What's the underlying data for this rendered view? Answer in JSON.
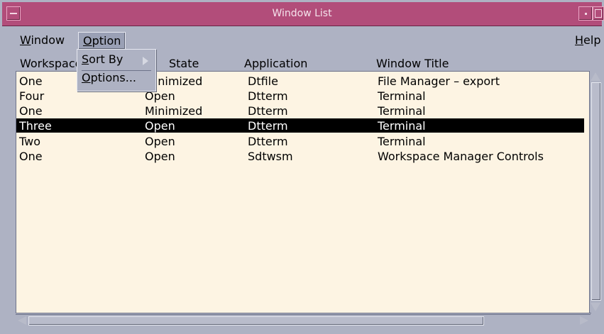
{
  "window": {
    "title": "Window List",
    "colors": {
      "titlebar": "#b24d7a",
      "chrome": "#aeb2c3",
      "list_bg": "#fdf4e3",
      "selected_bg": "#000000",
      "selected_fg": "#ffffff"
    }
  },
  "menubar": {
    "window": {
      "prefix": "",
      "underline": "W",
      "rest": "indow"
    },
    "option": {
      "prefix": "",
      "underline": "O",
      "rest": "ption"
    },
    "help": {
      "prefix": "",
      "underline": "H",
      "rest": "elp"
    }
  },
  "dropdown": {
    "sort_by": {
      "underline": "S",
      "rest": "ort By",
      "submenu_icon": "triangle-right-icon"
    },
    "options": {
      "underline": "O",
      "rest": "ptions..."
    }
  },
  "columns": {
    "workspace": "Workspace",
    "state": "State",
    "application": "Application",
    "window_title": "Window Title"
  },
  "rows": [
    {
      "workspace": "One",
      "state": "Minimized",
      "application": "Dtfile",
      "window_title": "File Manager – export"
    },
    {
      "workspace": "Four",
      "state": "Open",
      "application": "Dtterm",
      "window_title": "Terminal"
    },
    {
      "workspace": "One",
      "state": "Minimized",
      "application": "Dtterm",
      "window_title": "Terminal"
    },
    {
      "workspace": "Three",
      "state": "Open",
      "application": "Dtterm",
      "window_title": "Terminal",
      "selected": true
    },
    {
      "workspace": "Two",
      "state": "Open",
      "application": "Dtterm",
      "window_title": "Terminal"
    },
    {
      "workspace": "One",
      "state": "Open",
      "application": "Sdtwsm",
      "window_title": "Workspace Manager Controls"
    }
  ],
  "icons": {
    "window_menu": "window-menu-icon",
    "minimize": "minimize-icon",
    "maximize": "maximize-icon",
    "scroll_up": "scroll-up-arrow-icon",
    "scroll_down": "scroll-down-arrow-icon",
    "scroll_left": "scroll-left-arrow-icon",
    "scroll_right": "scroll-right-arrow-icon"
  }
}
